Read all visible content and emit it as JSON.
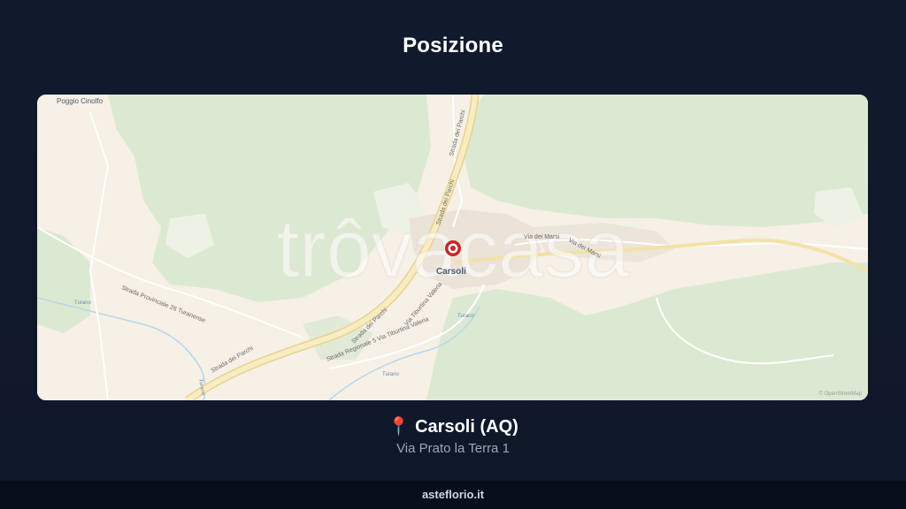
{
  "header": {
    "title": "Posizione"
  },
  "map": {
    "watermark": "trôvacasa",
    "attribution": "© OpenStreetMap",
    "labels": {
      "poggio": "Poggio Cinolfo",
      "town": "Carsoli",
      "via_marsi": "Via dei Marsi",
      "via_marsi_2": "Via dei Marsi",
      "strada_parchi_top": "Strada dei Parchi",
      "strada_parchi_mid": "Strada dei Parchi",
      "strada_parchi_low": "Strada dei Parchi",
      "strada_parchi_bottom": "Strada dei Parchi",
      "sp26": "Strada Provinciale 26 Turanense",
      "sr5": "Strada Regionale 5 Via Tiburtina Valeria",
      "tiburtina": "Via Tiburtina Valeria",
      "turano_1": "Turano",
      "turano_2": "Turano",
      "turano_3": "Turano",
      "turano_4": "Turano"
    },
    "colors": {
      "land": "#f6f0e6",
      "forest": "#dce9d2",
      "highway": "#f3e2a8",
      "marker": "#c62828"
    }
  },
  "location": {
    "pin_icon": "📍",
    "city": "Carsoli (AQ)",
    "address": "Via Prato la Terra 1"
  },
  "footer": {
    "site": "asteflorio.it"
  }
}
